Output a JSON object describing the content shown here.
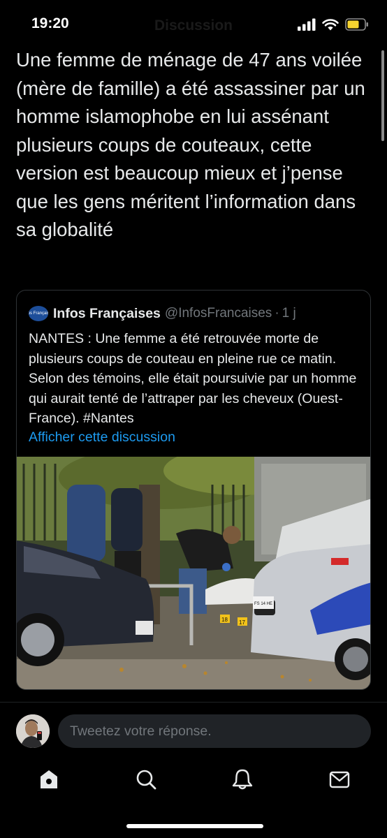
{
  "status_bar": {
    "time": "19:20",
    "header_title": "Discussion",
    "icons": [
      "cellular-signal-icon",
      "wifi-icon",
      "battery-icon"
    ],
    "battery_color": "#f5d330"
  },
  "tweet": {
    "text": "Une femme de ménage de 47 ans voilée (mère de famille) a été assassiner par un homme islamophobe en lui assénant plusieurs coups de couteaux, cette version est beaucoup mieux et j’pense que les gens méritent l’information dans sa globalité"
  },
  "quote": {
    "avatar_text": "Infos Françaises",
    "account_name": "Infos Françaises",
    "handle": "@InfosFrancaises",
    "separator": "·",
    "time": "1 j",
    "text": "NANTES : Une femme a été retrouvée morte de plusieurs coups de couteau en pleine rue ce matin. Selon des témoins, elle était poursuivie par un homme qui aurait tenté de l’attraper par les cheveux (Ouest-France). #Nantes",
    "show_thread_link": "Afficher cette discussion",
    "photo": {
      "subject": "crime-scene-photo",
      "marker_labels": [
        "18",
        "17"
      ],
      "police_plate_text": "FS 14 HE"
    }
  },
  "reply": {
    "placeholder": "Tweetez votre réponse."
  },
  "tab_bar": {
    "items": [
      {
        "name": "home-icon",
        "active": true
      },
      {
        "name": "search-icon",
        "active": false
      },
      {
        "name": "notifications-icon",
        "active": false
      },
      {
        "name": "messages-icon",
        "active": false
      }
    ]
  },
  "colors": {
    "background": "#000000",
    "text": "#e7e9ea",
    "secondary_text": "#71767b",
    "link": "#1d9bf0",
    "border": "#2f3336"
  }
}
